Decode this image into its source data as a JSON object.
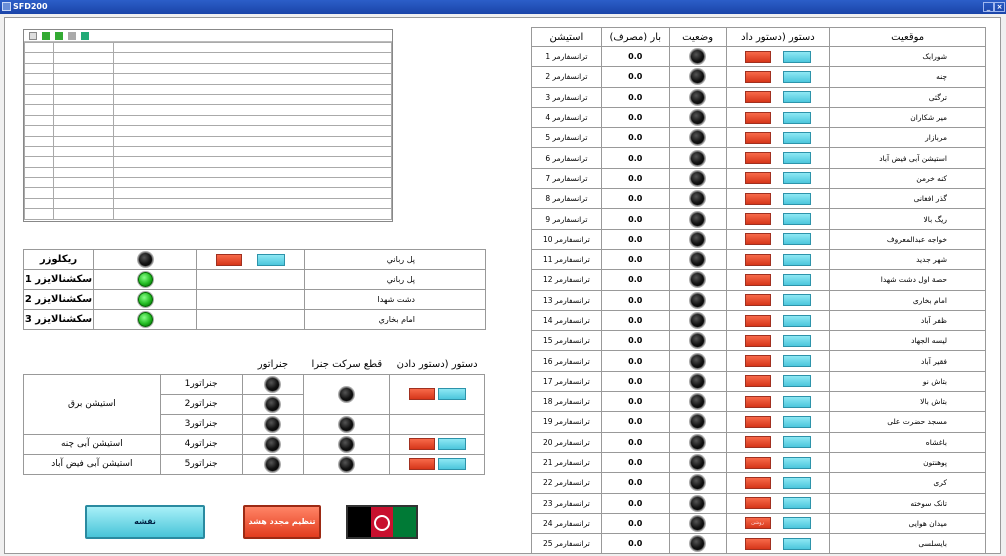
{
  "window": {
    "title": "SFD200"
  },
  "right_table": {
    "headers": [
      "موقعیت",
      "دستور (دستور داد",
      "وضعیت",
      "(بار (مصرف",
      "استیشن"
    ],
    "rows": [
      {
        "location": "شورابک",
        "value": "0.0",
        "station": "ترانسفارمر 1"
      },
      {
        "location": "چنه",
        "value": "0.0",
        "station": "ترانسفارمر 2"
      },
      {
        "location": "ترگئی",
        "value": "0.0",
        "station": "ترانسفارمر 3"
      },
      {
        "location": "میر شکاران",
        "value": "0.0",
        "station": "ترانسفارمر 4"
      },
      {
        "location": "مربازار",
        "value": "0.0",
        "station": "ترانسفارمر 5"
      },
      {
        "location": "استیشن آبی فیض آباد",
        "value": "0.0",
        "station": "ترانسفارمر 6"
      },
      {
        "location": "کنه خرمن",
        "value": "0.0",
        "station": "ترانسفارمر 7"
      },
      {
        "location": "گذر افغانی",
        "value": "0.0",
        "station": "ترانسفارمر 8"
      },
      {
        "location": "ریگ بالا",
        "value": "0.0",
        "station": "ترانسفارمر 9"
      },
      {
        "location": "خواجه عبدالمعروف",
        "value": "0.0",
        "station": "ترانسفارمر 10"
      },
      {
        "location": "شهر جدید",
        "value": "0.0",
        "station": "ترانسفارمر 11"
      },
      {
        "location": "حصة اول دشت شهدا",
        "value": "0.0",
        "station": "ترانسفارمر 12"
      },
      {
        "location": "امام بخاری",
        "value": "0.0",
        "station": "ترانسفارمر 13"
      },
      {
        "location": "ظفر آباد",
        "value": "0.0",
        "station": "ترانسفارمر 14"
      },
      {
        "location": "لیسه الجهاد",
        "value": "0.0",
        "station": "ترانسفارمر 15"
      },
      {
        "location": "فقیر آباد",
        "value": "0.0",
        "station": "ترانسفارمر 16"
      },
      {
        "location": "بتاش نو",
        "value": "0.0",
        "station": "ترانسفارمر 17"
      },
      {
        "location": "بتاش بالا",
        "value": "0.0",
        "station": "ترانسفارمر 18"
      },
      {
        "location": "مسجد حضرت علی",
        "value": "0.0",
        "station": "ترانسفارمر 19"
      },
      {
        "location": "باغشاه",
        "value": "0.0",
        "station": "ترانسفارمر 20"
      },
      {
        "location": "پوهنتون",
        "value": "0.0",
        "station": "ترانسفارمر 21"
      },
      {
        "location": "کری",
        "value": "0.0",
        "station": "ترانسفارمر 22"
      },
      {
        "location": "تانک سوخته",
        "value": "0.0",
        "station": "ترانسفارمر 23"
      },
      {
        "location": "میدان هوایی",
        "value": "0.0",
        "station": "ترانسفارمر 24",
        "red_label": "روشن"
      },
      {
        "location": "بایسلسی",
        "value": "0.0",
        "station": "ترانسفارمر 25"
      }
    ]
  },
  "reclosers": {
    "rows": [
      {
        "name": "ریکلوزر",
        "location": "پل رباني",
        "led": "off",
        "buttons": true
      },
      {
        "name": "سکشنالایزر 1",
        "location": "پل رباني",
        "led": "on",
        "buttons": false
      },
      {
        "name": "سکشنالایزر 2",
        "location": "دشت شهدا",
        "led": "on",
        "buttons": false
      },
      {
        "name": "سکشنالایزر 3",
        "location": "امام بخاري",
        "led": "on",
        "buttons": false
      }
    ]
  },
  "generators": {
    "headers": [
      "جنراتور",
      "قطع سرکت جنرا",
      "دستور (دستور دادن"
    ],
    "station_electric": "استیشن برق",
    "station_chena": "استیشن آبی چنه",
    "station_faizabad": "استیشن آبی فیض آباد",
    "gen1": "جنراتور1",
    "gen2": "جنراتور2",
    "gen3": "جنراتور3",
    "gen4": "جنراتور4",
    "gen5": "جنراتور5"
  },
  "buttons": {
    "map": "نقشه",
    "reset_alarm": "تنظیم مجدد هشد"
  },
  "flag_colors": [
    "#000000",
    "#c8102e",
    "#007a36"
  ]
}
